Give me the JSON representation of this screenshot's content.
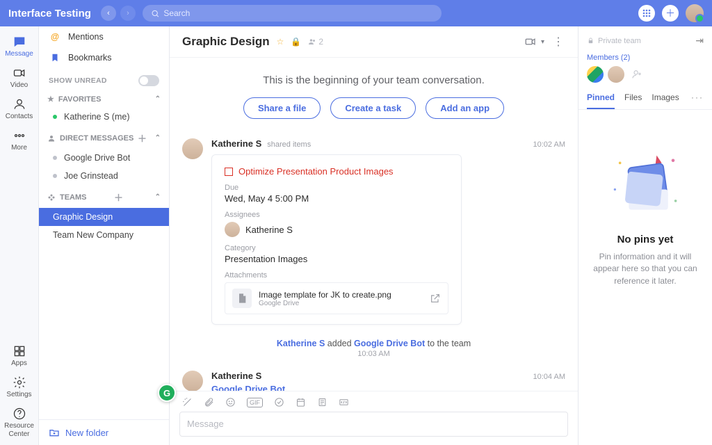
{
  "app_title": "Interface Testing",
  "search": {
    "placeholder": "Search"
  },
  "rail": {
    "message": "Message",
    "video": "Video",
    "contacts": "Contacts",
    "more": "More",
    "apps": "Apps",
    "settings": "Settings",
    "resource_center": "Resource\nCenter"
  },
  "sidebar": {
    "mentions": "Mentions",
    "bookmarks": "Bookmarks",
    "show_unread": "SHOW UNREAD",
    "favorites": "FAVORITES",
    "fav_items": [
      "Katherine S (me)"
    ],
    "dm_heading": "DIRECT MESSAGES",
    "dm_items": [
      "Google Drive Bot",
      "Joe Grinstead"
    ],
    "teams_heading": "TEAMS",
    "team_items": [
      "Graphic Design",
      "Team New Company"
    ],
    "new_folder": "New folder"
  },
  "chat": {
    "title": "Graphic Design",
    "member_count": "2",
    "beginning": "This is the beginning of your team conversation.",
    "pill1": "Share a file",
    "pill2": "Create a task",
    "pill3": "Add an app",
    "msg1": {
      "author": "Katherine S",
      "meta": "shared items",
      "time": "10:02 AM",
      "task_title": "Optimize Presentation Product Images",
      "due_label": "Due",
      "due_value": "Wed, May 4 5:00 PM",
      "assignees_label": "Assignees",
      "assignee_name": "Katherine S",
      "category_label": "Category",
      "category_value": "Presentation Images",
      "attach_label": "Attachments",
      "file_name": "Image template for JK to create.png",
      "file_src": "Google Drive"
    },
    "sys": {
      "who": "Katherine S",
      "mid": " added ",
      "target": "Google Drive Bot",
      "tail": " to the team",
      "time": "10:03 AM"
    },
    "msg2": {
      "author": "Katherine S",
      "time": "10:04 AM",
      "link": "Google Drive Bot"
    },
    "composer_placeholder": "Message"
  },
  "right": {
    "private": "Private team",
    "members_link": "Members (2)",
    "tabs": {
      "pinned": "Pinned",
      "files": "Files",
      "images": "Images"
    },
    "empty_title": "No pins yet",
    "empty_body": "Pin information and it will appear here so that you can reference it later."
  }
}
